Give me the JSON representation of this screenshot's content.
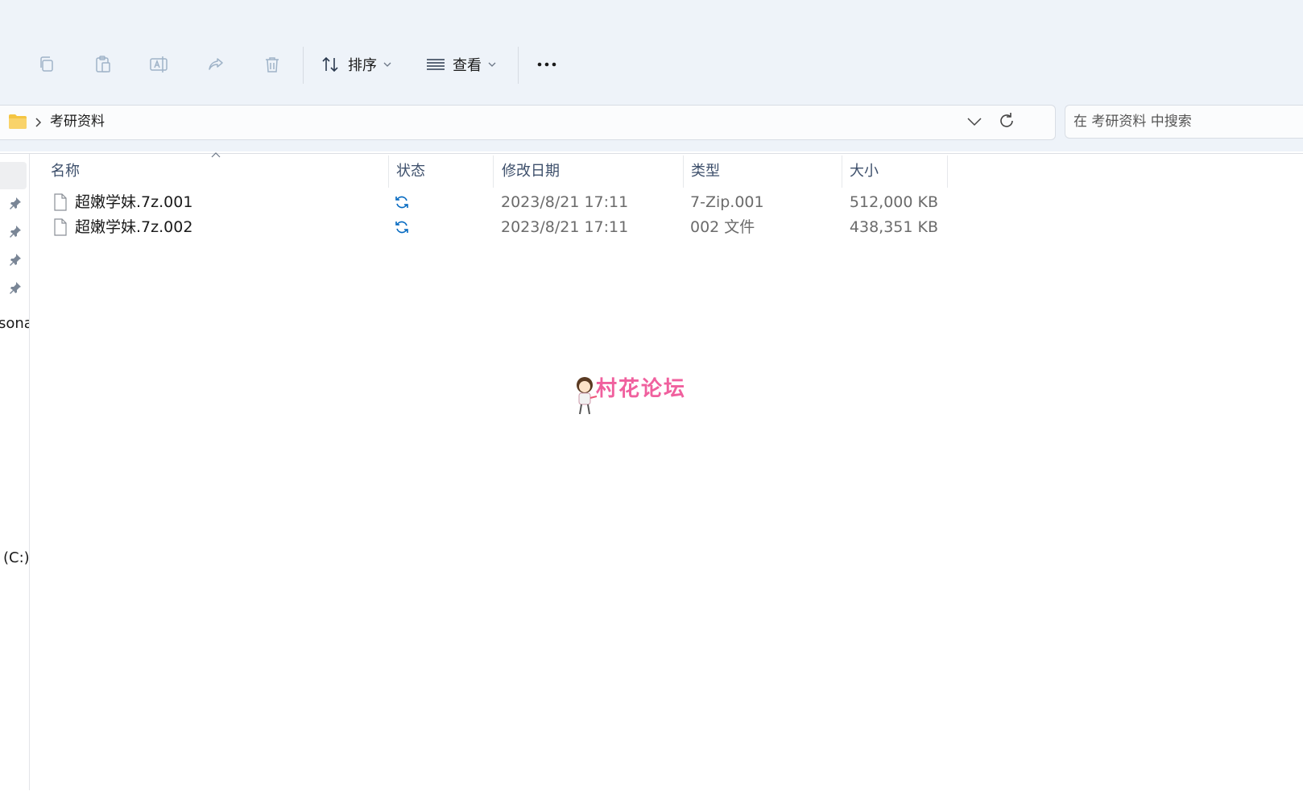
{
  "toolbar": {
    "sort_label": "排序",
    "view_label": "查看"
  },
  "address": {
    "path": "考研资料"
  },
  "search": {
    "placeholder": "在 考研资料 中搜索"
  },
  "nav": {
    "partial_item": "sona",
    "drive_item": "(C:)"
  },
  "columns": [
    "名称",
    "状态",
    "修改日期",
    "类型",
    "大小"
  ],
  "files": [
    {
      "name": "超嫩学妹.7z.001",
      "date": "2023/8/21 17:11",
      "type": "7-Zip.001",
      "size": "512,000 KB"
    },
    {
      "name": "超嫩学妹.7z.002",
      "date": "2023/8/21 17:11",
      "type": "002 文件",
      "size": "438,351 KB"
    }
  ],
  "watermark": {
    "text": "村花论坛",
    "color": "#f0609e"
  },
  "colors": {
    "accent": "#0067c0",
    "folder": "#f4c542"
  }
}
